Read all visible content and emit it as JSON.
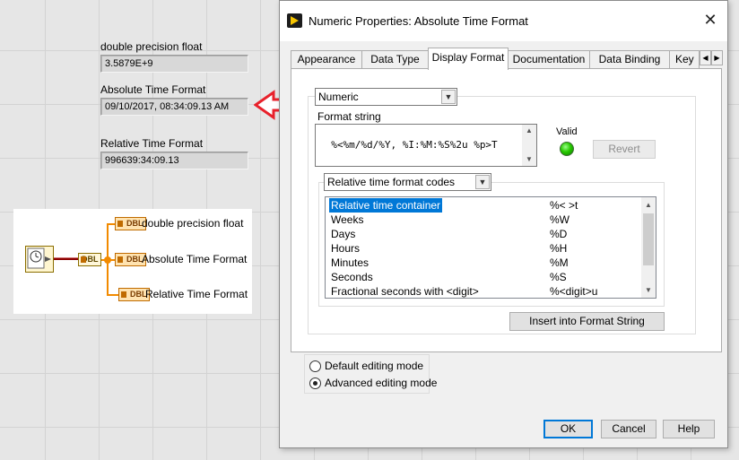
{
  "front_panel": {
    "dbl_label": "double precision float",
    "dbl_value": "3.5879E+9",
    "abs_label": "Absolute Time Format",
    "abs_value": "09/10/2017, 08:34:09.13 AM",
    "rel_label": "Relative Time Format",
    "rel_value": "996639:34:09.13"
  },
  "block_diagram": {
    "source_term": "DBL",
    "term_dbl": "DBL",
    "term_abs": "DBL",
    "term_rel": "DBL",
    "label_dbl": "double precision float",
    "label_abs": "Absolute Time Format",
    "label_rel": "Relative Time Format"
  },
  "dialog": {
    "title": "Numeric Properties: Absolute Time Format",
    "close_glyph": "✕",
    "tabs": [
      "Appearance",
      "Data Type",
      "Display Format",
      "Documentation",
      "Data Binding",
      "Key"
    ],
    "active_tab": "Display Format",
    "type_select": "Numeric",
    "format_string_label": "Format string",
    "format_string_value": "%<%m/%d/%Y, %I:%M:%S%2u %p>T",
    "valid_label": "Valid",
    "revert_label": "Revert",
    "codes_select": "Relative time format codes",
    "codes": [
      {
        "name": "Relative time container",
        "code": "%< >t"
      },
      {
        "name": "Weeks",
        "code": "%W"
      },
      {
        "name": "Days",
        "code": "%D"
      },
      {
        "name": "Hours",
        "code": "%H"
      },
      {
        "name": "Minutes",
        "code": "%M"
      },
      {
        "name": "Seconds",
        "code": "%S"
      },
      {
        "name": "Fractional seconds with <digit>",
        "code": "%<digit>u"
      }
    ],
    "insert_label": "Insert into Format String",
    "mode_default": "Default editing mode",
    "mode_advanced": "Advanced editing mode",
    "selected_mode": "advanced",
    "ok_label": "OK",
    "cancel_label": "Cancel",
    "help_label": "Help"
  },
  "colors": {
    "accent": "#0078d7",
    "arrow": "#e8212b",
    "wire": "#f28a00",
    "valid_led": "#27c900"
  },
  "icons": [
    "labview-app-icon",
    "close-icon",
    "chevron-down-icon",
    "arrow-left-icon",
    "radio-icon"
  ]
}
